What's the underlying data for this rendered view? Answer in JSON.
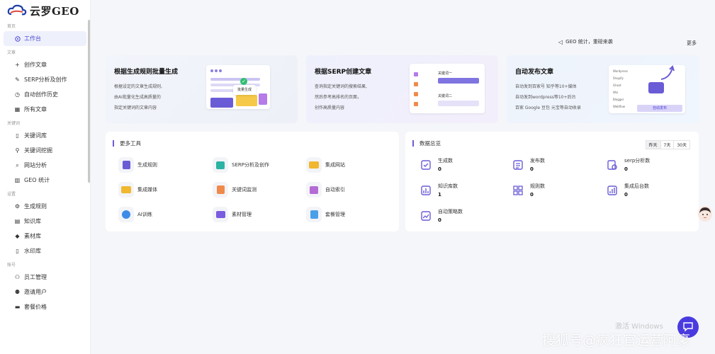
{
  "app": {
    "logo_text": "云罗GEO"
  },
  "sidebar": {
    "sections": [
      {
        "label": "首页",
        "items": [
          {
            "label": "工作台",
            "icon": "home-icon",
            "active": true
          }
        ]
      },
      {
        "label": "文章",
        "items": [
          {
            "label": "创作文章",
            "icon": "plus-icon"
          },
          {
            "label": "SERP分析及创作",
            "icon": "pen-icon"
          },
          {
            "label": "自动创作历史",
            "icon": "clock-icon"
          },
          {
            "label": "所有文章",
            "icon": "grid-icon"
          }
        ]
      },
      {
        "label": "关键词",
        "items": [
          {
            "label": "关键词库",
            "icon": "doc-icon"
          },
          {
            "label": "关键词挖掘",
            "icon": "location-icon"
          },
          {
            "label": "网站分析",
            "icon": "search-icon"
          },
          {
            "label": "GEO 统计",
            "icon": "bar-chart-icon"
          }
        ]
      },
      {
        "label": "设置",
        "items": [
          {
            "label": "生成规则",
            "icon": "gear-icon"
          },
          {
            "label": "知识库",
            "icon": "book-icon"
          },
          {
            "label": "素材库",
            "icon": "cube-icon"
          },
          {
            "label": "水印库",
            "icon": "doc-icon"
          }
        ]
      },
      {
        "label": "账号",
        "items": [
          {
            "label": "员工管理",
            "icon": "users-icon"
          },
          {
            "label": "邀请用户",
            "icon": "user-icon"
          },
          {
            "label": "套餐价格",
            "icon": "card-icon"
          }
        ]
      }
    ]
  },
  "topbar": {
    "notice": "GEO 统计，重磅来袭",
    "more": "更多"
  },
  "cards": [
    {
      "title": "根据生成规则批量生成",
      "lines": [
        "根据设定的文章生成规则,",
        "由AI批量化生成高质量的",
        "指定关键词的文章内容"
      ],
      "ill_badge": "批量生成"
    },
    {
      "title": "根据SERP创建文章",
      "lines": [
        "查询指定关键词的搜索结果,",
        "然后参考高排名的页面，",
        "创作高质量内容"
      ],
      "ill_kw1": "关键词一",
      "ill_kw2": "关键词二"
    },
    {
      "title": "自动发布文章",
      "lines": [
        "自动发到百家号 知乎等10+媒体",
        "自动发到wordpress等10+后台",
        "百家 Google 豆包 元宝等自动收录"
      ],
      "ill_btn": "自动发布",
      "ill_list": [
        "Wordpress",
        "Shopify",
        "Ghost",
        "Wix",
        "Blogger",
        "Webflow"
      ]
    }
  ],
  "tools": {
    "title": "更多工具",
    "items": [
      {
        "label": "生成规则",
        "icon": "rule-icon",
        "color": "#6a5cd6"
      },
      {
        "label": "SERP分析及创作",
        "icon": "serp-icon",
        "color": "#2bb3a3"
      },
      {
        "label": "集成网站",
        "icon": "website-icon",
        "color": "#f1b72f"
      },
      {
        "label": "集成媒体",
        "icon": "media-icon",
        "color": "#f1b72f"
      },
      {
        "label": "关键词监测",
        "icon": "monitor-icon",
        "color": "#f08a4b"
      },
      {
        "label": "自动索引",
        "icon": "index-icon",
        "color": "#b46bd6"
      },
      {
        "label": "AI训练",
        "icon": "ai-icon",
        "color": "#3d8be6"
      },
      {
        "label": "素材管理",
        "icon": "folder-icon",
        "color": "#7a5ce0"
      },
      {
        "label": "套餐管理",
        "icon": "package-icon",
        "color": "#4b9fe8"
      }
    ]
  },
  "stats": {
    "title": "数据总览",
    "ranges": [
      "昨天",
      "7天",
      "30天"
    ],
    "items": [
      {
        "label": "生成数",
        "value": "0",
        "icon": "generate-icon"
      },
      {
        "label": "发布数",
        "value": "0",
        "icon": "publish-icon"
      },
      {
        "label": "serp分析数",
        "value": "0",
        "icon": "serp-stat-icon"
      },
      {
        "label": "知识库数",
        "value": "1",
        "icon": "knowledge-icon"
      },
      {
        "label": "规则数",
        "value": "0",
        "icon": "rules-icon"
      },
      {
        "label": "集成后台数",
        "value": "0",
        "icon": "backend-icon"
      },
      {
        "label": "自动策略数",
        "value": "0",
        "icon": "strategy-icon"
      }
    ]
  },
  "watermark": {
    "windows": "激活 Windows",
    "source": "搜狐号@疯狂官运营阿豪"
  }
}
